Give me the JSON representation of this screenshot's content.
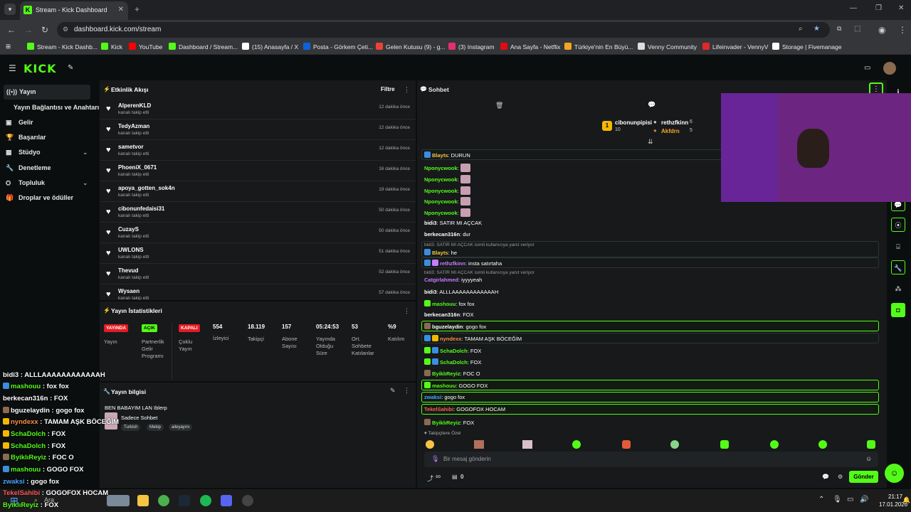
{
  "browser": {
    "tab_title": "Stream - Kick Dashboard",
    "url": "dashboard.kick.com/stream",
    "bookmarks": [
      {
        "label": "Stream - Kick Dashb...",
        "color": "#53fc18"
      },
      {
        "label": "Kick",
        "color": "#53fc18"
      },
      {
        "label": "YouTube",
        "color": "#ff0000"
      },
      {
        "label": "Dashboard / Stream...",
        "color": "#53fc18"
      },
      {
        "label": "(15) Anasayfa / X",
        "color": "#ffffff"
      },
      {
        "label": "Posta - Görkem Çeti...",
        "color": "#0a64d8"
      },
      {
        "label": "Gelen Kutusu (9) - g...",
        "color": "#ea4335"
      },
      {
        "label": "(3) Instagram",
        "color": "#e1306c"
      },
      {
        "label": "Ana Sayfa - Netflix",
        "color": "#e50914"
      },
      {
        "label": "Türkiye'nin En Büyü...",
        "color": "#f5a623"
      },
      {
        "label": "Venny Community",
        "color": "#dddddd"
      },
      {
        "label": "Lifeinvader - VennyV",
        "color": "#e0282c"
      },
      {
        "label": "Storage | Fivemanage",
        "color": "#ffffff"
      }
    ]
  },
  "kick": {
    "logo": "KICK"
  },
  "sidebar": {
    "items": [
      {
        "label": "Yayın",
        "icon": "broadcast-icon"
      },
      {
        "label": "Yayın Bağlantısı ve Anahtarı",
        "icon": ""
      },
      {
        "label": "Gelir",
        "icon": "wallet-icon"
      },
      {
        "label": "Başarılar",
        "icon": "trophy-icon"
      },
      {
        "label": "Stüdyo",
        "icon": "studio-icon"
      },
      {
        "label": "Denetleme",
        "icon": "wrench-icon"
      },
      {
        "label": "Topluluk",
        "icon": "community-icon"
      },
      {
        "label": "Droplar ve ödüller",
        "icon": "gift-icon"
      }
    ]
  },
  "activity": {
    "title": "Etkinlik Akışı",
    "filter": "Filtre",
    "followed_text": "kanalı takip etti",
    "rows": [
      {
        "user": "AlperenKLD",
        "time": "12 dakika önce"
      },
      {
        "user": "TedyAzman",
        "time": "12 dakika önce"
      },
      {
        "user": "sametvor",
        "time": "12 dakika önce"
      },
      {
        "user": "PhoeniX_0671",
        "time": "16 dakika önce"
      },
      {
        "user": "apoya_gotten_sok4n",
        "time": "19 dakika önce"
      },
      {
        "user": "cibonunfedaisi31",
        "time": "50 dakika önce"
      },
      {
        "user": "CuzayS",
        "time": "50 dakika önce"
      },
      {
        "user": "UWLONS",
        "time": "51 dakika önce"
      },
      {
        "user": "Thevud",
        "time": "52 dakika önce"
      },
      {
        "user": "Wysaen",
        "time": "57 dakika önce"
      }
    ]
  },
  "stats": {
    "title": "Yayın İstatistikleri",
    "live_badge": "YAYINDA",
    "live_label": "Yayın",
    "partner_badge": "AÇIK",
    "partner_label": "Partnerlik Gelir Programı",
    "multi_badge": "KAPALI",
    "multi_label": "Çoklu Yayın",
    "viewers": "554",
    "viewers_label": "İzleyici",
    "followers": "18.119",
    "followers_label": "Takipçi",
    "subs": "157",
    "subs_label": "Abone Sayısı",
    "uptime": "05:24:53",
    "uptime_label": "Yayında Olduğu Süre",
    "chatters": "53",
    "chatters_label": "Ort. Sohbete Katılanlar",
    "participation": "%9",
    "participation_label": "Katılım"
  },
  "info": {
    "title": "Yayın bilgisi",
    "stream_title": "BEN BABAYIM LAN Iblerp",
    "category": "Sadece Sohbet",
    "tags": [
      "Turkish",
      "Mekip",
      "aileyayını"
    ]
  },
  "chat": {
    "title": "Sohbet",
    "leaderboard": {
      "first": {
        "user": "cibonunpipisi",
        "count": "10"
      },
      "second": {
        "user": "rethzfkinn",
        "count": "6"
      },
      "third": {
        "user": "Akfdrn",
        "count": "5"
      }
    },
    "messages": [
      {
        "user": "Blayts",
        "text": ": DURUN",
        "color": "#f5c542"
      },
      {
        "user": "Nponycwook",
        "text": ":",
        "color": "#53fc18",
        "emote": true
      },
      {
        "user": "Nponycwook",
        "text": ":",
        "color": "#53fc18",
        "emote": true
      },
      {
        "user": "Nponycwook",
        "text": ":",
        "color": "#53fc18",
        "emote": true
      },
      {
        "user": "Nponycwook",
        "text": ":",
        "color": "#53fc18",
        "emote": true
      },
      {
        "user": "Nponycwook",
        "text": ":",
        "color": "#53fc18",
        "emote": true
      },
      {
        "user": "bidi3",
        "text": ": SATIR MI AÇCAK",
        "color": "#ffffff"
      },
      {
        "user": "berkecan316n",
        "text": ": dur",
        "color": "#ffffff"
      },
      {
        "reply": "bidi3: SATIR MI AÇCAK isimli kullanıcıya yanıt veriyor",
        "user": "Blayts",
        "text": ": he",
        "color": "#f5c542"
      },
      {
        "user": "rethzfkinn",
        "text": ": insta satırtaha",
        "color": "#c77dff"
      },
      {
        "reply": "bidi3: SATIR MI AÇCAK isimli kullanıcıya yanıt veriyor",
        "user": "Catgirlahmed",
        "text": ": iyyyyeah",
        "color": "#c77dff"
      },
      {
        "user": "bidi3",
        "text": ": ALLLAAAAAAAAAAAAH",
        "color": "#ffffff"
      },
      {
        "user": "mashouu",
        "text": ": fox fox",
        "color": "#53fc18"
      },
      {
        "user": "berkecan316n",
        "text": ": FOX",
        "color": "#ffffff"
      },
      {
        "user": "bguzelaydin",
        "text": ": gogo fox",
        "color": "#ffffff"
      },
      {
        "user": "nyndexx",
        "text": ": TAMAM AŞK BÖCEĞİM",
        "color": "#ff8c42"
      },
      {
        "user": "SchaDolch",
        "text": ": FOX",
        "color": "#53fc18"
      },
      {
        "user": "SchaDolch",
        "text": ": FOX",
        "color": "#53fc18"
      },
      {
        "user": "ByiklıReyiz",
        "text": ": FOC O",
        "color": "#ffffff"
      },
      {
        "user": "mashouu",
        "text": ": GOGO FOX",
        "color": "#53fc18"
      },
      {
        "user": "zwaksi",
        "text": ": gogo fox",
        "color": "#4aa3ff"
      },
      {
        "user": "TekelSahibi",
        "text": ": GOGOFOX HOCAM",
        "color": "#ff5a5a"
      },
      {
        "user": "ByiklıReyiz",
        "text": ": FOX",
        "color": "#ffffff"
      }
    ],
    "followers_only": "Takipçilere Özel",
    "input_placeholder": "Bir mesaj gönderin",
    "infinity": "∞",
    "count": "0",
    "send": "Gönder"
  },
  "overlay": {
    "lines": [
      {
        "user": "bidi3",
        "text": " : ALLLAAAAAAAAAAAAH",
        "color": "#ffffff"
      },
      {
        "user": "mashouu",
        "text": " : fox fox",
        "color": "#53fc18"
      },
      {
        "user": "berkecan316n",
        "text": " : FOX",
        "color": "#ffffff"
      },
      {
        "user": "bguzelaydin",
        "text": " : gogo fox",
        "color": "#ffffff"
      },
      {
        "user": "nyndexx",
        "text": " : TAMAM AŞK BÖCEĞİM",
        "color": "#ff8c42"
      },
      {
        "user": "SchaDolch",
        "text": " : FOX",
        "color": "#53fc18"
      },
      {
        "user": "SchaDolch",
        "text": " : FOX",
        "color": "#53fc18"
      },
      {
        "user": "ByiklıReyiz",
        "text": " : FOC O",
        "color": "#53fc18"
      },
      {
        "user": "mashouu",
        "text": " : GOGO FOX",
        "color": "#53fc18"
      },
      {
        "user": "zwaksi",
        "text": " : gogo fox",
        "color": "#4aa3ff"
      },
      {
        "user": "TekelSahibi",
        "text": " : GOGOFOX HOCAM",
        "color": "#ff5a5a"
      },
      {
        "user": "ByiklıReyiz",
        "text": " : FOX",
        "color": "#53fc18"
      }
    ]
  },
  "taskbar": {
    "search": "Ara",
    "time": "21:17",
    "date": "17.01.2026"
  }
}
